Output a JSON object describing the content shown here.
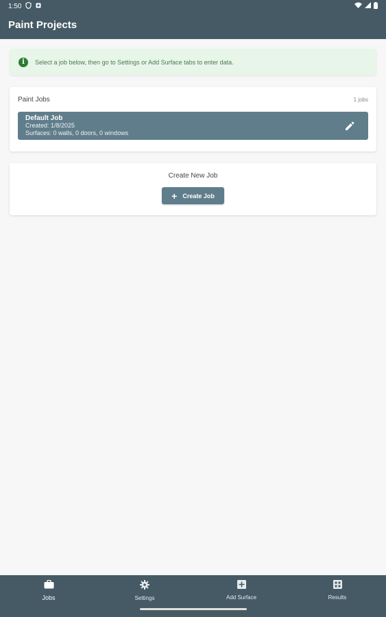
{
  "status_bar": {
    "time": "1:50"
  },
  "app_bar": {
    "title": "Paint Projects"
  },
  "info_banner": {
    "icon": "info-icon",
    "text": "Select a job below, then go to Settings or Add Surface tabs to enter data."
  },
  "jobs_card": {
    "title": "Paint Jobs",
    "count": "1 jobs",
    "jobs": [
      {
        "name": "Default Job",
        "created": "Created: 1/8/2025",
        "surfaces": "Surfaces: 0 walls, 0 doors, 0 windows"
      }
    ]
  },
  "create_card": {
    "title": "Create New Job",
    "button_label": "Create Job"
  },
  "bottom_nav": {
    "items": [
      {
        "label": "Jobs",
        "icon": "briefcase-icon",
        "active": true
      },
      {
        "label": "Settings",
        "icon": "gear-icon",
        "active": false
      },
      {
        "label": "Add Surface",
        "icon": "add-box-icon",
        "active": false
      },
      {
        "label": "Results",
        "icon": "grid-icon",
        "active": false
      }
    ]
  },
  "colors": {
    "primary": "#455a64",
    "accent": "#607d8b",
    "banner_bg": "#e8f5e9",
    "banner_icon": "#2e7d32"
  }
}
